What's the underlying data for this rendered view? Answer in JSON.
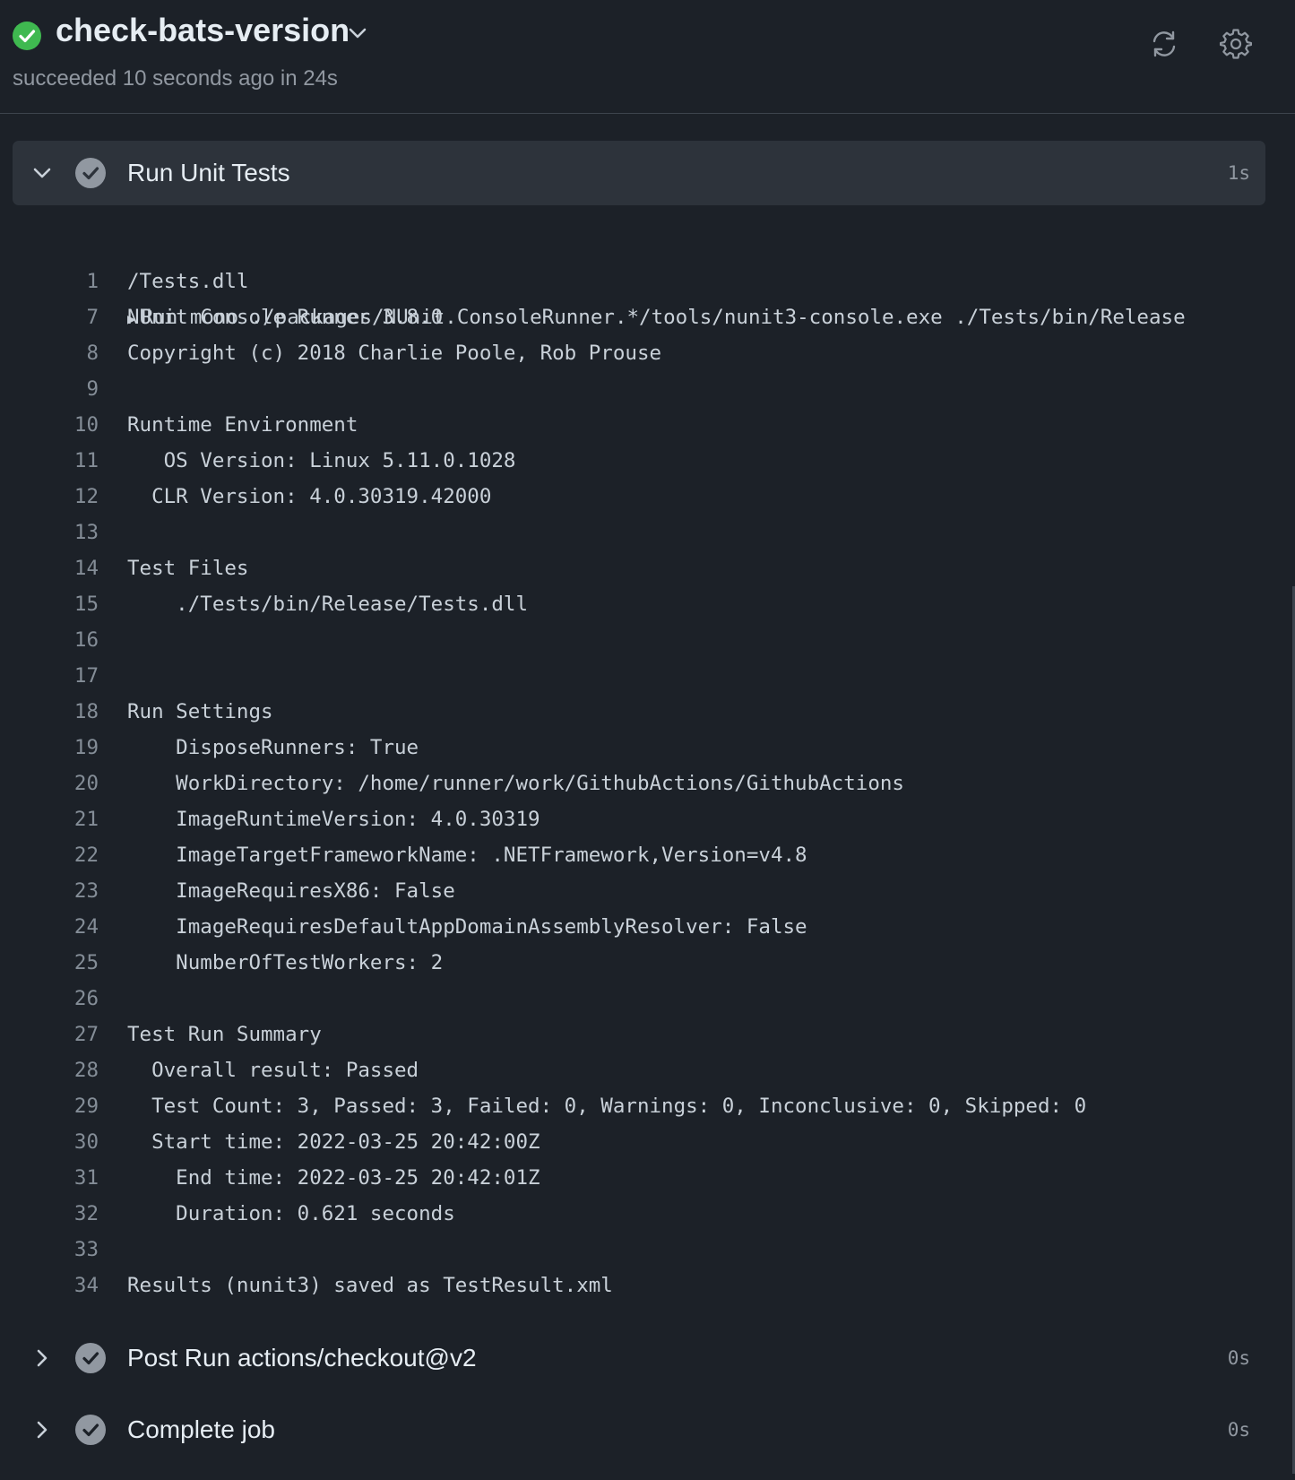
{
  "header": {
    "title": "check-bats-version",
    "subtitle": "succeeded 10 seconds ago in 24s",
    "status": "success",
    "status_color": "#3fb950"
  },
  "steps": [
    {
      "name": "Run Unit Tests",
      "duration": "1s",
      "expanded": true
    },
    {
      "name": "Post Run actions/checkout@v2",
      "duration": "0s",
      "expanded": false
    },
    {
      "name": "Complete job",
      "duration": "0s",
      "expanded": false
    }
  ],
  "log": [
    {
      "n": "1",
      "text": "Run mono ./packages/NUnit.ConsoleRunner.*/tools/nunit3-console.exe ./Tests/bin/Release",
      "cont": "/Tests.dll"
    },
    {
      "n": "7",
      "text": "NUnit Console Runner 3.8.0"
    },
    {
      "n": "8",
      "text": "Copyright (c) 2018 Charlie Poole, Rob Prouse"
    },
    {
      "n": "9",
      "text": ""
    },
    {
      "n": "10",
      "text": "Runtime Environment"
    },
    {
      "n": "11",
      "text": "   OS Version: Linux 5.11.0.1028"
    },
    {
      "n": "12",
      "text": "  CLR Version: 4.0.30319.42000"
    },
    {
      "n": "13",
      "text": ""
    },
    {
      "n": "14",
      "text": "Test Files"
    },
    {
      "n": "15",
      "text": "    ./Tests/bin/Release/Tests.dll"
    },
    {
      "n": "16",
      "text": ""
    },
    {
      "n": "17",
      "text": ""
    },
    {
      "n": "18",
      "text": "Run Settings"
    },
    {
      "n": "19",
      "text": "    DisposeRunners: True"
    },
    {
      "n": "20",
      "text": "    WorkDirectory: /home/runner/work/GithubActions/GithubActions"
    },
    {
      "n": "21",
      "text": "    ImageRuntimeVersion: 4.0.30319"
    },
    {
      "n": "22",
      "text": "    ImageTargetFrameworkName: .NETFramework,Version=v4.8"
    },
    {
      "n": "23",
      "text": "    ImageRequiresX86: False"
    },
    {
      "n": "24",
      "text": "    ImageRequiresDefaultAppDomainAssemblyResolver: False"
    },
    {
      "n": "25",
      "text": "    NumberOfTestWorkers: 2"
    },
    {
      "n": "26",
      "text": ""
    },
    {
      "n": "27",
      "text": "Test Run Summary"
    },
    {
      "n": "28",
      "text": "  Overall result: Passed"
    },
    {
      "n": "29",
      "text": "  Test Count: 3, Passed: 3, Failed: 0, Warnings: 0, Inconclusive: 0, Skipped: 0"
    },
    {
      "n": "30",
      "text": "  Start time: 2022-03-25 20:42:00Z"
    },
    {
      "n": "31",
      "text": "    End time: 2022-03-25 20:42:01Z"
    },
    {
      "n": "32",
      "text": "    Duration: 0.621 seconds"
    },
    {
      "n": "33",
      "text": ""
    },
    {
      "n": "34",
      "text": "Results (nunit3) saved as TestResult.xml"
    }
  ]
}
